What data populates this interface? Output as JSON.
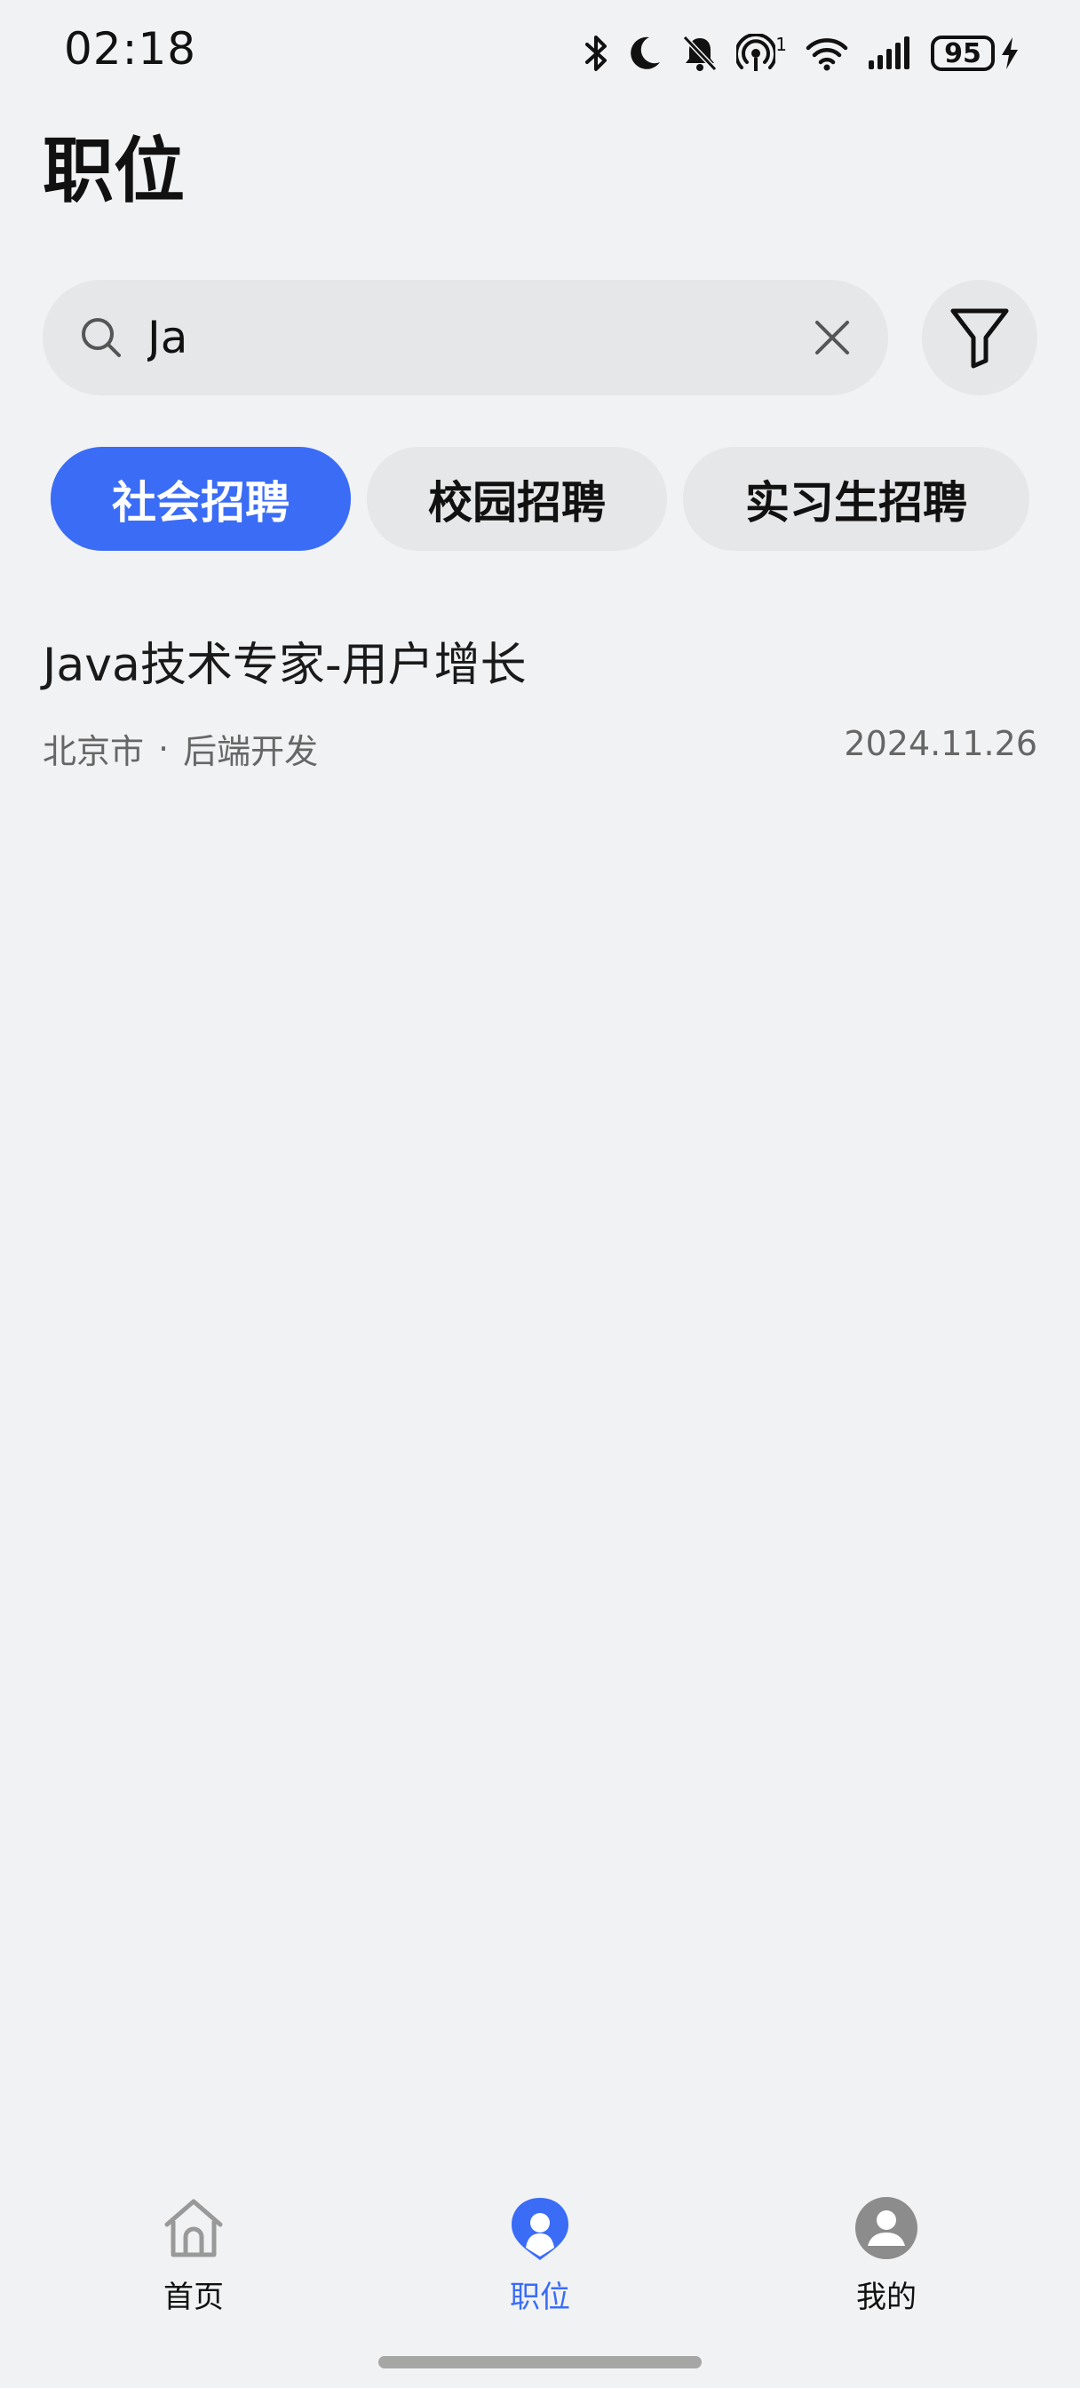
{
  "status_bar": {
    "time": "02:18",
    "battery_level": "95",
    "hotspot_count": "1",
    "icons": [
      "bluetooth-icon",
      "moon-icon",
      "bell-off-icon",
      "hotspot-icon",
      "wifi-icon",
      "signal-icon",
      "battery-icon",
      "charging-icon"
    ]
  },
  "header": {
    "title": "职位"
  },
  "search": {
    "value": "Ja",
    "placeholder": ""
  },
  "tabs": [
    {
      "label": "社会招聘",
      "active": true
    },
    {
      "label": "校园招聘",
      "active": false
    },
    {
      "label": "实习生招聘",
      "active": false
    }
  ],
  "jobs": [
    {
      "title": "Java技术专家-用户增长",
      "location": "北京市",
      "separator": "·",
      "category": "后端开发",
      "date": "2024.11.26"
    }
  ],
  "bottom_nav": [
    {
      "label": "首页",
      "icon": "home-icon",
      "active": false
    },
    {
      "label": "职位",
      "icon": "job-icon",
      "active": true
    },
    {
      "label": "我的",
      "icon": "profile-icon",
      "active": false
    }
  ],
  "colors": {
    "accent": "#3a6cf6",
    "background": "#f1f2f4",
    "chip_background": "#e6e7e9"
  }
}
